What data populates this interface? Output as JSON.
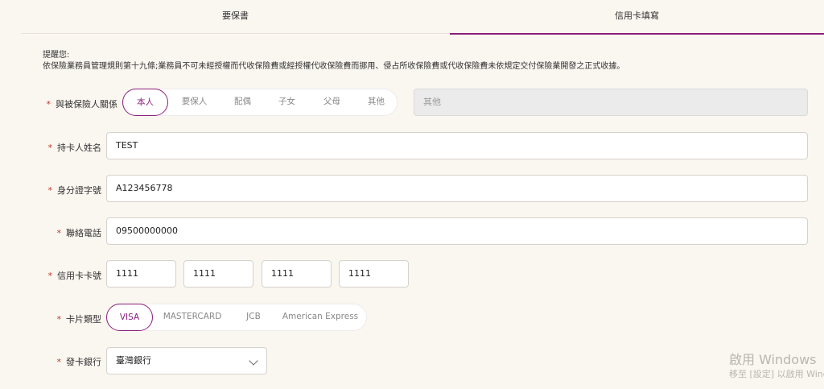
{
  "tabs": [
    {
      "label": "要保書",
      "active": false
    },
    {
      "label": "信用卡填寫",
      "active": true
    }
  ],
  "notice": {
    "title": "提醒您:",
    "body": "依保險業務員管理規則第十九條;業務員不可未經授權而代收保險費或經授權代收保險費而挪用、侵占所收保險費或代收保險費未依規定交付保險業開發之正式收據。"
  },
  "relationship": {
    "label": "與被保險人關係",
    "options": [
      "本人",
      "要保人",
      "配偶",
      "子女",
      "父母",
      "其他"
    ],
    "selected": "本人",
    "other_placeholder": "其他"
  },
  "cardholder_name": {
    "label": "持卡人姓名",
    "value": "TEST"
  },
  "id_number": {
    "label": "身分證字號",
    "value": "A123456778"
  },
  "phone": {
    "label": "聯絡電話",
    "value": "09500000000"
  },
  "card_number": {
    "label": "信用卡卡號",
    "parts": [
      "1111",
      "1111",
      "1111",
      "1111"
    ]
  },
  "card_type": {
    "label": "卡片類型",
    "options": [
      "VISA",
      "MASTERCARD",
      "JCB",
      "American Express"
    ],
    "selected": "VISA"
  },
  "issuing_bank": {
    "label": "發卡銀行",
    "value": "臺灣銀行",
    "icon": "chevron-down-icon"
  },
  "watermark": {
    "line1": "啟用 Windows",
    "line2": "移至 [設定] 以啟用 Windows。"
  },
  "colors": {
    "accent": "#8b1f7c",
    "required": "#c0392b",
    "background": "#faf6f0"
  }
}
